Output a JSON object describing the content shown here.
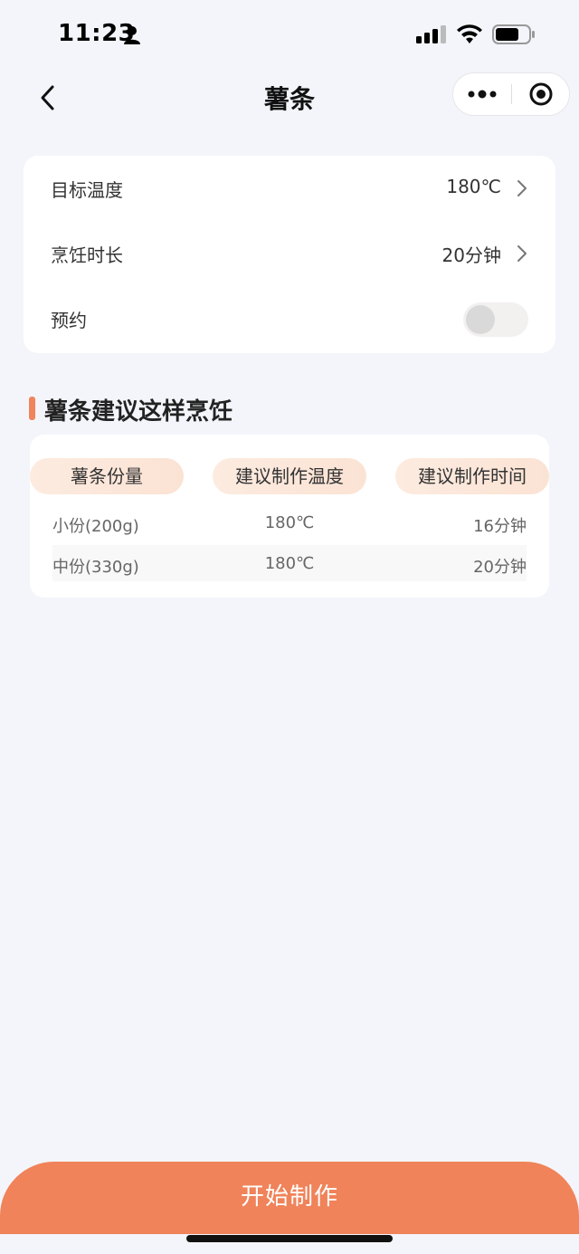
{
  "status_bar": {
    "time": "11:23"
  },
  "nav": {
    "title": "薯条"
  },
  "settings": {
    "temperature": {
      "label": "目标温度",
      "value": "180℃"
    },
    "duration": {
      "label": "烹饪时长",
      "value": "20分钟"
    },
    "reservation": {
      "label": "预约",
      "enabled": false
    }
  },
  "suggestion": {
    "title": "薯条建议这样烹饪",
    "headers": [
      "薯条份量",
      "建议制作温度",
      "建议制作时间"
    ],
    "rows": [
      [
        "小份(200g)",
        "180℃",
        "16分钟"
      ],
      [
        "中份(330g)",
        "180℃",
        "20分钟"
      ]
    ]
  },
  "actions": {
    "start_label": "开始制作"
  },
  "colors": {
    "accent": "#f0835a",
    "background": "#f4f5fa"
  }
}
